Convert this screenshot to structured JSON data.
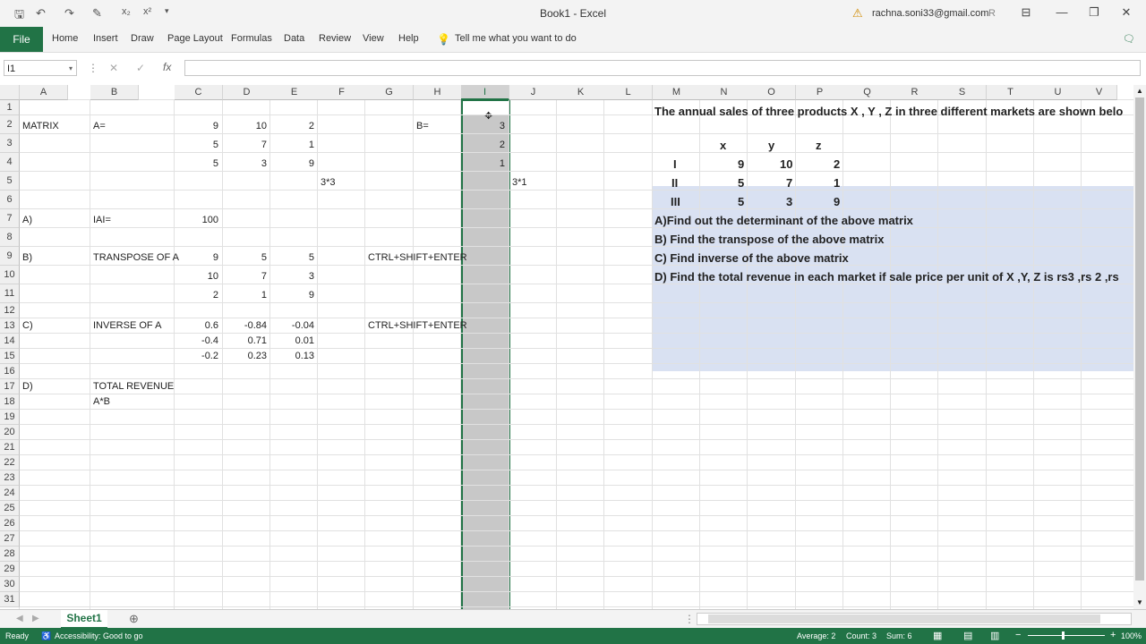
{
  "window": {
    "title": "Book1  -  Excel",
    "account": "rachna.soni33@gmail.com",
    "account_initial": "R"
  },
  "ribbon": {
    "file": "File",
    "tabs": [
      "Home",
      "Insert",
      "Draw",
      "Page Layout",
      "Formulas",
      "Data",
      "Review",
      "View",
      "Help"
    ],
    "tell_me": "Tell me what you want to do"
  },
  "formula_bar": {
    "name_box": "I1",
    "fx": "fx",
    "content": ""
  },
  "columns": [
    "A",
    "B",
    "C",
    "D",
    "E",
    "F",
    "G",
    "H",
    "I",
    "J",
    "K",
    "L",
    "M",
    "N",
    "O",
    "P",
    "Q",
    "R",
    "S",
    "T",
    "U",
    "V"
  ],
  "rows": [
    "1",
    "2",
    "3",
    "4",
    "5",
    "6",
    "7",
    "8",
    "9",
    "10",
    "11",
    "12",
    "13",
    "14",
    "15",
    "16",
    "17",
    "18",
    "19",
    "20",
    "21",
    "22",
    "23",
    "24",
    "25",
    "26",
    "27",
    "28",
    "29",
    "30",
    "31"
  ],
  "cells": {
    "A2": "MATRIX",
    "B2": "A=",
    "C2": "9",
    "D2": "10",
    "E2": "2",
    "H2": "B=",
    "I2": "3",
    "C3": "5",
    "D3": "7",
    "E3": "1",
    "I3": "2",
    "C4": "5",
    "D4": "3",
    "E4": "9",
    "I4": "1",
    "F5": "3*3",
    "J5": "3*1",
    "A7": "A)",
    "B7": "IAI=",
    "C7": "100",
    "A9": "B)",
    "B9": "TRANSPOSE OF A",
    "C9": "9",
    "D9": "5",
    "E9": "5",
    "G9": "CTRL+SHIFT+ENTER",
    "C10": "10",
    "D10": "7",
    "E10": "3",
    "C11": "2",
    "D11": "1",
    "E11": "9",
    "A13": "C)",
    "B13": "INVERSE OF A",
    "C13": "0.6",
    "D13": "-0.84",
    "E13": "-0.04",
    "G13": "CTRL+SHIFT+ENTER",
    "C14": "-0.4",
    "D14": "0.71",
    "E14": "0.01",
    "C15": "-0.2",
    "D15": "0.23",
    "E15": "0.13",
    "A17": "D)",
    "B17": "TOTAL REVENUE",
    "B18": "A*B"
  },
  "question": {
    "intro": "The annual sales of three products X , Y , Z  in three different markets are shown belo",
    "headers": [
      "x",
      "y",
      "z"
    ],
    "rows": [
      [
        "I",
        "9",
        "10",
        "2"
      ],
      [
        "II",
        "5",
        "7",
        "1"
      ],
      [
        "III",
        "5",
        "3",
        "9"
      ]
    ],
    "a": "A)Find out the determinant of the above matrix",
    "b": "B) Find the transpose of the above matrix",
    "c": "C) Find inverse of the above matrix",
    "d": "D) Find the total revenue in each market if sale price per unit of X ,Y, Z is rs3 ,rs 2 ,rs"
  },
  "sheet_tab": "Sheet1",
  "status": {
    "ready": "Ready",
    "accessibility": "Accessibility: Good to go",
    "average": "Average: 2",
    "count": "Count: 3",
    "sum": "Sum: 6",
    "zoom": "100%"
  }
}
